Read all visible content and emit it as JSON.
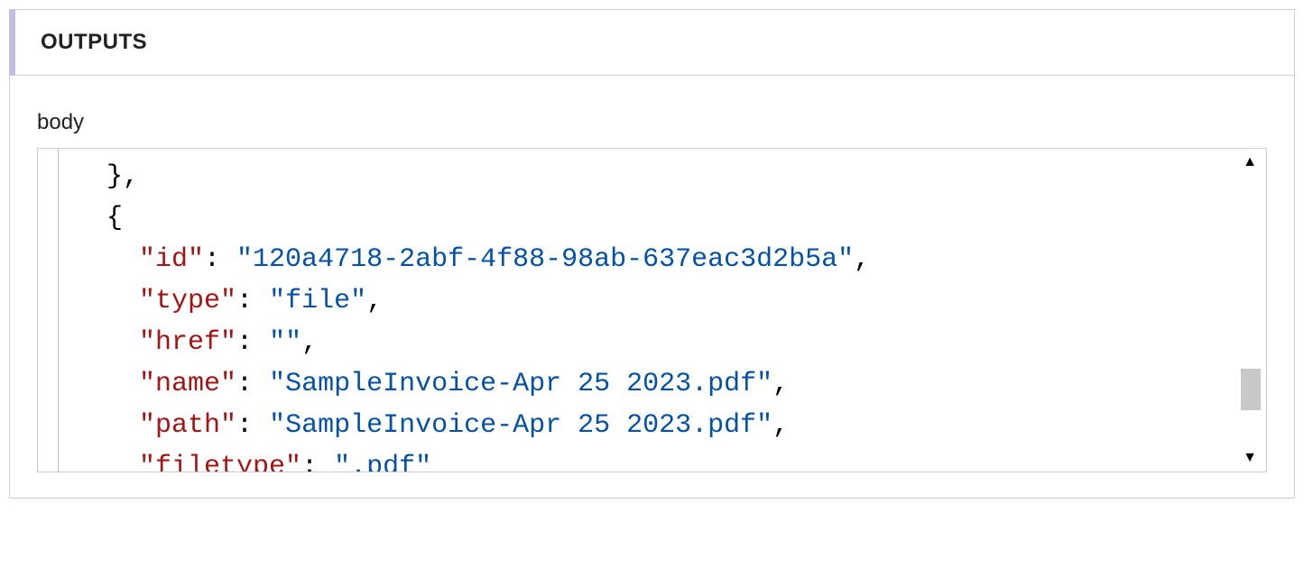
{
  "panel": {
    "header": "OUTPUTS",
    "body_label": "body"
  },
  "code": {
    "line1": "  },",
    "line2": "  {",
    "indent": "    ",
    "k_id": "\"id\"",
    "v_id": "\"120a4718-2abf-4f88-98ab-637eac3d2b5a\"",
    "k_type": "\"type\"",
    "v_type": "\"file\"",
    "k_href": "\"href\"",
    "v_href": "\"\"",
    "k_name": "\"name\"",
    "v_name": "\"SampleInvoice-Apr 25 2023.pdf\"",
    "k_path": "\"path\"",
    "v_path": "\"SampleInvoice-Apr 25 2023.pdf\"",
    "k_filetype": "\"filetype\"",
    "v_filetype": "\".pdf\"",
    "colon": ": ",
    "comma": ","
  }
}
